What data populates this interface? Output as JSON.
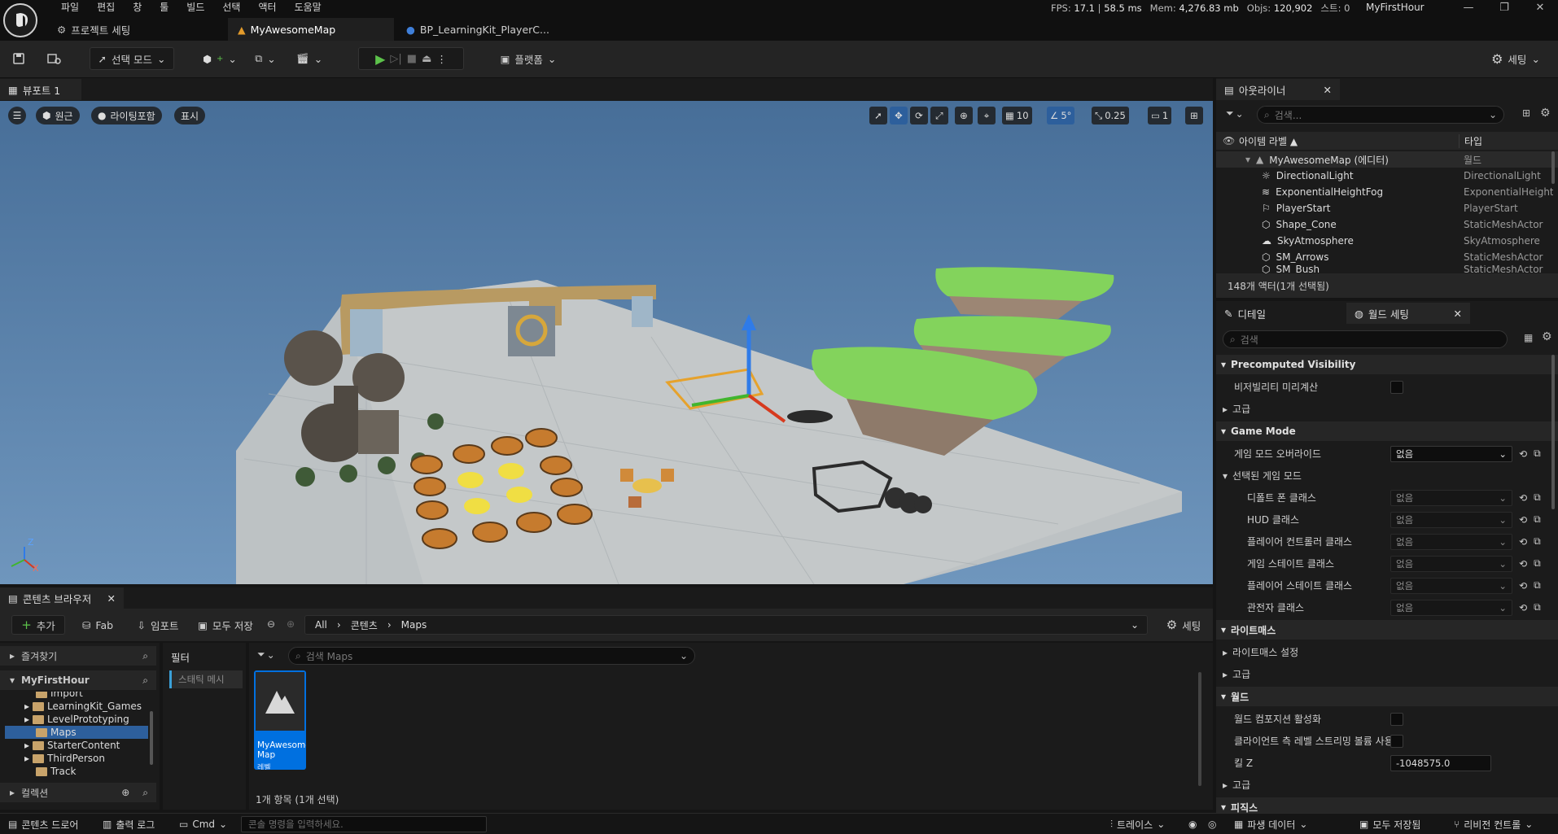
{
  "menu": [
    "파일",
    "편집",
    "창",
    "툴",
    "빌드",
    "선택",
    "액터",
    "도움말"
  ],
  "tabs": [
    {
      "label": "프로젝트 세팅"
    },
    {
      "label": "MyAwesomeMap"
    },
    {
      "label": "BP_LearningKit_PlayerC..."
    }
  ],
  "stats": {
    "fps_label": "FPS:",
    "fps": "17.1",
    "ms": "58.5 ms",
    "mem_label": "Mem:",
    "mem": "4,276.83 mb",
    "objs_label": "Objs:",
    "objs": "120,902",
    "streaming": "스트: 0"
  },
  "project_name": "MyFirstHour",
  "toolbar": {
    "select_mode": "선택 모드",
    "platform": "플랫폼",
    "settings": "세팅"
  },
  "viewport": {
    "tab": "뷰포트 1",
    "perspective": "원근",
    "lighting": "라이팅포함",
    "show": "표시",
    "grid_snap": "10",
    "angle_snap": "5°",
    "scale_snap": "0.25",
    "camera_speed": "1",
    "axis_z": "Z",
    "axis_x": "X"
  },
  "outliner": {
    "tab": "아웃라이너",
    "search_placeholder": "검색...",
    "col_label": "아이템 라벨 ▲",
    "col_type": "타입",
    "rows": [
      {
        "name": "MyAwesomeMap (에디터)",
        "type": "월드"
      },
      {
        "name": "DirectionalLight",
        "type": "DirectionalLight"
      },
      {
        "name": "ExponentialHeightFog",
        "type": "ExponentialHeight"
      },
      {
        "name": "PlayerStart",
        "type": "PlayerStart"
      },
      {
        "name": "Shape_Cone",
        "type": "StaticMeshActor"
      },
      {
        "name": "SkyAtmosphere",
        "type": "SkyAtmosphere"
      },
      {
        "name": "SM_Arrows",
        "type": "StaticMeshActor"
      },
      {
        "name": "SM_Bush",
        "type": "StaticMeshActor"
      }
    ],
    "footer": "148개 액터(1개 선택됨)"
  },
  "details": {
    "tab1": "디테일",
    "tab2": "월드 세팅",
    "search_placeholder": "검색",
    "sec_precomputed": "Precomputed Visibility",
    "precompute_vis": "비저빌리티 미리계산",
    "advanced": "고급",
    "sec_gamemode": "Game Mode",
    "gamemode_override": "게임 모드 오버라이드",
    "none": "없음",
    "selected_gamemode": "선택된 게임 모드",
    "default_pawn": "디폴트 폰 클래스",
    "hud": "HUD 클래스",
    "player_controller": "플레이어 컨트롤러 클래스",
    "game_state": "게임 스테이트 클래스",
    "player_state": "플레이어 스테이트 클래스",
    "spectator": "관전자 클래스",
    "sec_lightmass": "라이트매스",
    "lightmass_settings": "라이트매스 설정",
    "sec_world": "월드",
    "world_comp": "월드 컴포지션 활성화",
    "client_streaming": "클라이언트 측 레벨 스트리밍 볼륨 사용",
    "kill_z": "킬 Z",
    "kill_z_value": "-1048575.0",
    "sec_physics": "피직스"
  },
  "content_browser": {
    "tab": "콘텐츠 브라우저",
    "add": "추가",
    "fab": "Fab",
    "import": "임포트",
    "save_all": "모두 저장",
    "path": [
      "All",
      "콘텐츠",
      "Maps"
    ],
    "settings": "세팅",
    "favorites": "즐겨찾기",
    "project": "MyFirstHour",
    "folders": [
      "Import",
      "LearningKit_Games",
      "LevelPrototyping",
      "Maps",
      "StarterContent",
      "ThirdPerson",
      "Track"
    ],
    "collections": "컬렉션",
    "filter_title": "필터",
    "filter_chip": "스태틱 메시",
    "search_placeholder": "검색 Maps",
    "asset_name": "MyAwesome Map",
    "asset_type": "레벨",
    "item_count": "1개 항목 (1개 선택)"
  },
  "statusbar": {
    "drawer": "콘텐츠 드로어",
    "output_log": "출력 로그",
    "cmd": "Cmd",
    "console_placeholder": "콘솔 명령을 입력하세요.",
    "trace": "트레이스",
    "derived_data": "파생 데이터",
    "save_all": "모두 저장됨",
    "revision": "리비전 컨트롤"
  },
  "colors": {
    "accent": "#0070e0",
    "play_green": "#5cc24a",
    "folder": "#c8a36a"
  }
}
